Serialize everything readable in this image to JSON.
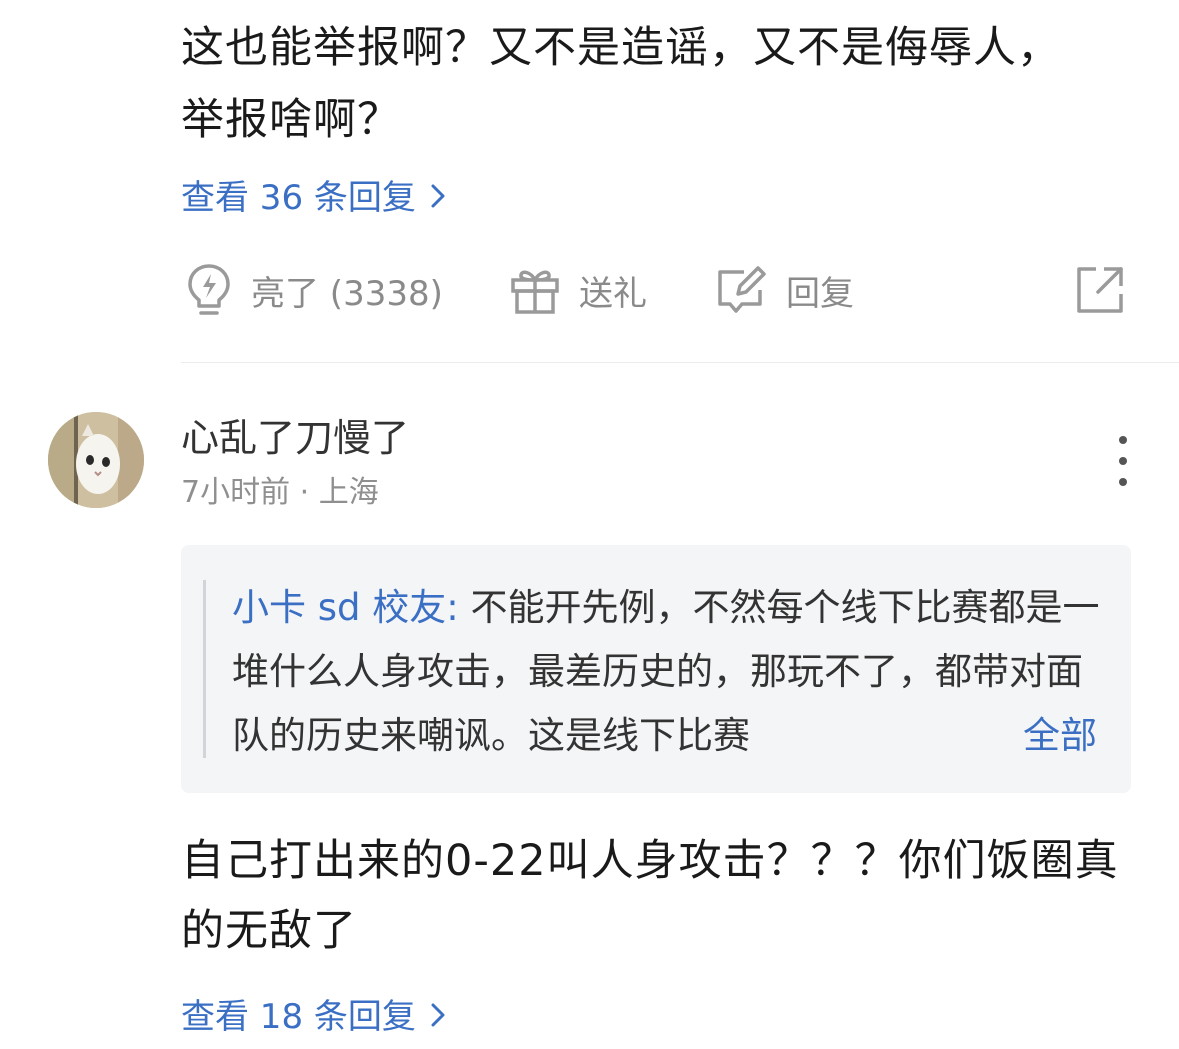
{
  "comment1": {
    "text": "这也能举报啊？又不是造谣，又不是侮辱人，举报啥啊？",
    "view_replies": "查看 36 条回复",
    "actions": {
      "like_label": "亮了 (3338)",
      "gift_label": "送礼",
      "reply_label": "回复"
    }
  },
  "comment2": {
    "username": "心乱了刀慢了",
    "meta": "7小时前 · 上海",
    "quote": {
      "user": "小卡 sd 校友:",
      "text": " 不能开先例，不然每个线下比赛都是一堆什么人身攻击，最差历史的，那玩不了，都带对面队的历史来嘲讽。这是线下比赛",
      "expand_label": "全部"
    },
    "text": "自己打出来的0-22叫人身攻击？？？你们饭圈真的无敌了",
    "view_replies": "查看 18 条回复"
  },
  "colors": {
    "link": "#3a6fc4",
    "muted": "#8a8a8a",
    "quote_bg": "#f4f5f7"
  },
  "icons": [
    "lightbulb-icon",
    "gift-icon",
    "edit-reply-icon",
    "share-icon",
    "more-vertical-icon",
    "chevron-right-icon"
  ]
}
